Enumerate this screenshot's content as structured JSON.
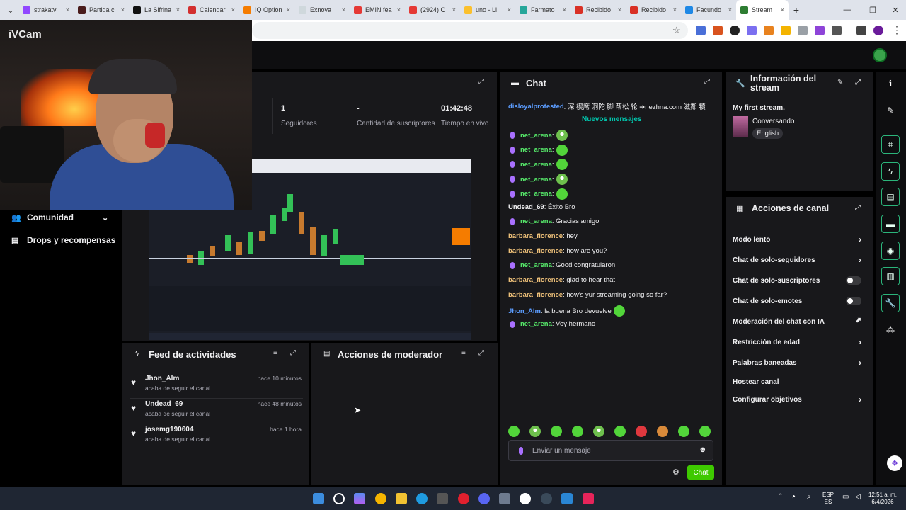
{
  "browser": {
    "tabs": [
      {
        "label": "strakatv",
        "color": "#9147ff"
      },
      {
        "label": "Partida c",
        "color": "#4a1c1c"
      },
      {
        "label": "La Sifrina",
        "color": "#111111"
      },
      {
        "label": "Calendar",
        "color": "#d32f2f"
      },
      {
        "label": "IQ Option",
        "color": "#f57c00"
      },
      {
        "label": "Exnova",
        "color": "#cfd8dc"
      },
      {
        "label": "EMIN fea",
        "color": "#e53935"
      },
      {
        "label": "(2924) C",
        "color": "#e53935"
      },
      {
        "label": "uno - Li",
        "color": "#fbc02d"
      },
      {
        "label": "Farmato",
        "color": "#26a69a"
      },
      {
        "label": "Recibido",
        "color": "#d93025"
      },
      {
        "label": "Recibido",
        "color": "#d93025"
      },
      {
        "label": "Facundo",
        "color": "#1e88e5"
      },
      {
        "label": "Stream",
        "color": "#2e7d32"
      }
    ],
    "new_tab": "+",
    "tab_close": "×",
    "minimize": "—",
    "restore": "❐",
    "close": "✕"
  },
  "ivcam": {
    "title": "iVCam"
  },
  "nav": {
    "comunidad": "Comunidad",
    "drops": "Drops y recompensas"
  },
  "stats": [
    {
      "value": "1",
      "label": "Seguidores"
    },
    {
      "value": "-",
      "label": "Cantidad de suscriptores"
    },
    {
      "value": "01:42:48",
      "label": "Tiempo en vivo"
    }
  ],
  "chat": {
    "title": "Chat",
    "first_line_user": "disloyalprotested",
    "first_line_text": ": 深 楔席 洞陀 脚 帮松 轮 ➔nezhna.com 滋鄰 犢",
    "new_messages": "Nuevos mensajes",
    "messages": [
      {
        "user": "net_arena",
        "text": ":",
        "mic": true,
        "user_color": "#56e86a",
        "emote": "frog"
      },
      {
        "user": "net_arena",
        "text": ":",
        "mic": true,
        "user_color": "#56e86a",
        "emote": "green"
      },
      {
        "user": "net_arena",
        "text": ":",
        "mic": true,
        "user_color": "#56e86a",
        "emote": "green"
      },
      {
        "user": "net_arena",
        "text": ":",
        "mic": true,
        "user_color": "#56e86a",
        "emote": "frog"
      },
      {
        "user": "net_arena",
        "text": ":",
        "mic": true,
        "user_color": "#56e86a",
        "emote": "green"
      },
      {
        "user": "Undead_69",
        "text": ": Éxito Bro",
        "mic": false,
        "user_color": "#efeff1",
        "emote": "none"
      },
      {
        "user": "net_arena",
        "text": ": Gracias amigo",
        "mic": true,
        "user_color": "#56e86a",
        "emote": "none"
      },
      {
        "user": "barbara_florence",
        "text": ": hey",
        "mic": false,
        "user_color": "#f0c27a",
        "emote": "none"
      },
      {
        "user": "barbara_florence",
        "text": ": how are you?",
        "mic": false,
        "user_color": "#f0c27a",
        "emote": "none"
      },
      {
        "user": "net_arena",
        "text": ": Good congratularon",
        "mic": true,
        "user_color": "#56e86a",
        "emote": "none"
      },
      {
        "user": "barbara_florence",
        "text": ": glad to hear that",
        "mic": false,
        "user_color": "#f0c27a",
        "emote": "none"
      },
      {
        "user": "barbara_florence",
        "text": ": how's yur streaming going so far?",
        "mic": false,
        "user_color": "#f0c27a",
        "emote": "none"
      },
      {
        "user": "Jhon_Alm",
        "text": ": la buena Bro devuelve",
        "mic": false,
        "user_color": "#5c9dff",
        "emote": "green"
      },
      {
        "user": "net_arena",
        "text": ": Voy hermano",
        "mic": true,
        "user_color": "#56e86a",
        "emote": "none"
      }
    ],
    "input_placeholder": "Enviar un mensaje",
    "send_label": "Chat"
  },
  "info": {
    "title": "Información del stream",
    "stream_title": "My first stream.",
    "category": "Conversando",
    "language": "English"
  },
  "actions": {
    "title": "Acciones de canal",
    "items": [
      {
        "label": "Modo lento",
        "control": "chevron"
      },
      {
        "label": "Chat de solo-seguidores",
        "control": "chevron"
      },
      {
        "label": "Chat de solo-suscriptores",
        "control": "toggle"
      },
      {
        "label": "Chat de solo-emotes",
        "control": "toggle"
      },
      {
        "label": "Moderación del chat con IA",
        "control": "external"
      },
      {
        "label": "Restricción de edad",
        "control": "chevron"
      },
      {
        "label": "Palabras baneadas",
        "control": "chevron"
      },
      {
        "label": "Hostear canal",
        "control": "none"
      },
      {
        "label": "Configurar objetivos",
        "control": "chevron"
      }
    ]
  },
  "feed": {
    "title": "Feed de actividades",
    "items": [
      {
        "user": "Jhon_Alm",
        "action": "acaba de seguir el canal",
        "time": "hace 10 minutos"
      },
      {
        "user": "Undead_69",
        "action": "acaba de seguir el canal",
        "time": "hace 48 minutos"
      },
      {
        "user": "josemg190604",
        "action": "acaba de seguir el canal",
        "time": "hace 1 hora"
      }
    ]
  },
  "mods": {
    "title": "Acciones de moderador"
  },
  "taskbar": {
    "lang_top": "ESP",
    "lang_bottom": "ES",
    "time": "12:51 a. m.",
    "date": "6/4/2026"
  }
}
